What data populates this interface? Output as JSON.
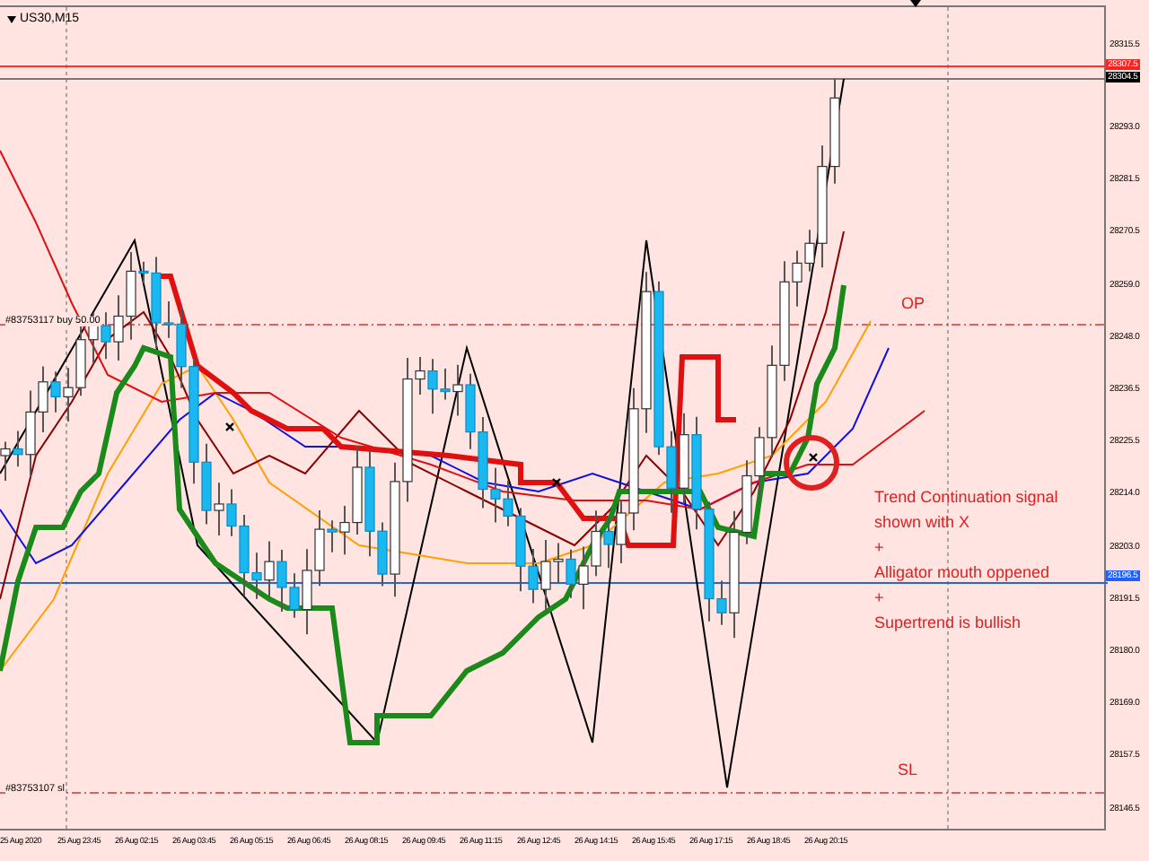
{
  "chart": {
    "symbol": "US30,M15",
    "order_labels": [
      {
        "text": "#83753117 buy 50.00",
        "kind": "entry"
      },
      {
        "text": "#83753107 sl",
        "kind": "stop"
      }
    ],
    "annotations": [
      {
        "text": "OP",
        "kind": "label"
      },
      {
        "kind": "note",
        "lines": [
          "Trend Continuation signal",
          "shown with X",
          "+",
          "Alligator mouth oppened",
          "+",
          "Supertrend is bullish"
        ]
      },
      {
        "text": "SL",
        "kind": "label"
      }
    ]
  },
  "price_axis": {
    "ticks": [
      "28315.5",
      "28293.0",
      "28281.5",
      "28270.5",
      "28259.0",
      "28248.0",
      "28236.5",
      "28225.5",
      "28214.0",
      "28203.0",
      "28191.5",
      "28180.0",
      "28169.0",
      "28157.5",
      "28146.5"
    ],
    "markers": [
      {
        "text": "28307.5",
        "kind": "bid"
      },
      {
        "text": "28304.5",
        "kind": "ask"
      },
      {
        "text": "28196.5",
        "kind": "line"
      }
    ]
  },
  "time_axis": {
    "labels": [
      "25 Aug 2020",
      "25 Aug 23:45",
      "26 Aug 02:15",
      "26 Aug 03:45",
      "26 Aug 05:15",
      "26 Aug 06:45",
      "26 Aug 08:15",
      "26 Aug 09:45",
      "26 Aug 11:15",
      "26 Aug 12:45",
      "26 Aug 14:15",
      "26 Aug 15:45",
      "26 Aug 17:15",
      "26 Aug 18:45",
      "26 Aug 20:15"
    ]
  }
}
